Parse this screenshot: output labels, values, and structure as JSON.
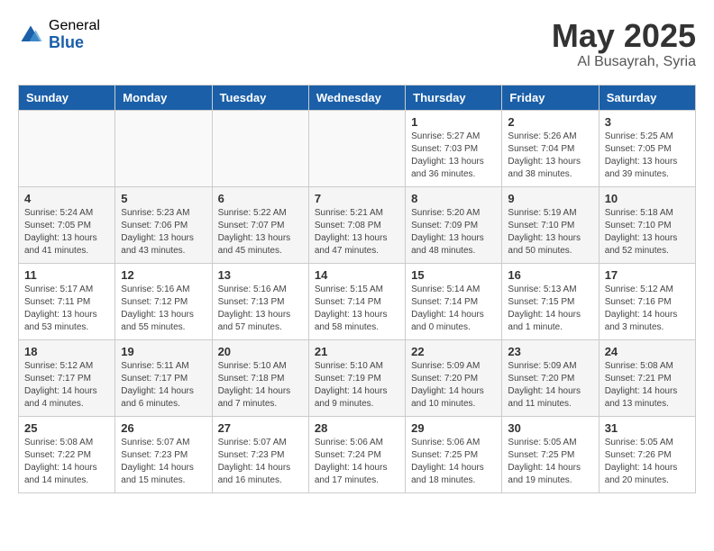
{
  "header": {
    "logo_general": "General",
    "logo_blue": "Blue",
    "month_title": "May 2025",
    "location": "Al Busayrah, Syria"
  },
  "days_of_week": [
    "Sunday",
    "Monday",
    "Tuesday",
    "Wednesday",
    "Thursday",
    "Friday",
    "Saturday"
  ],
  "weeks": [
    {
      "days": [
        {
          "num": "",
          "info": ""
        },
        {
          "num": "",
          "info": ""
        },
        {
          "num": "",
          "info": ""
        },
        {
          "num": "",
          "info": ""
        },
        {
          "num": "1",
          "info": "Sunrise: 5:27 AM\nSunset: 7:03 PM\nDaylight: 13 hours\nand 36 minutes."
        },
        {
          "num": "2",
          "info": "Sunrise: 5:26 AM\nSunset: 7:04 PM\nDaylight: 13 hours\nand 38 minutes."
        },
        {
          "num": "3",
          "info": "Sunrise: 5:25 AM\nSunset: 7:05 PM\nDaylight: 13 hours\nand 39 minutes."
        }
      ]
    },
    {
      "days": [
        {
          "num": "4",
          "info": "Sunrise: 5:24 AM\nSunset: 7:05 PM\nDaylight: 13 hours\nand 41 minutes."
        },
        {
          "num": "5",
          "info": "Sunrise: 5:23 AM\nSunset: 7:06 PM\nDaylight: 13 hours\nand 43 minutes."
        },
        {
          "num": "6",
          "info": "Sunrise: 5:22 AM\nSunset: 7:07 PM\nDaylight: 13 hours\nand 45 minutes."
        },
        {
          "num": "7",
          "info": "Sunrise: 5:21 AM\nSunset: 7:08 PM\nDaylight: 13 hours\nand 47 minutes."
        },
        {
          "num": "8",
          "info": "Sunrise: 5:20 AM\nSunset: 7:09 PM\nDaylight: 13 hours\nand 48 minutes."
        },
        {
          "num": "9",
          "info": "Sunrise: 5:19 AM\nSunset: 7:10 PM\nDaylight: 13 hours\nand 50 minutes."
        },
        {
          "num": "10",
          "info": "Sunrise: 5:18 AM\nSunset: 7:10 PM\nDaylight: 13 hours\nand 52 minutes."
        }
      ]
    },
    {
      "days": [
        {
          "num": "11",
          "info": "Sunrise: 5:17 AM\nSunset: 7:11 PM\nDaylight: 13 hours\nand 53 minutes."
        },
        {
          "num": "12",
          "info": "Sunrise: 5:16 AM\nSunset: 7:12 PM\nDaylight: 13 hours\nand 55 minutes."
        },
        {
          "num": "13",
          "info": "Sunrise: 5:16 AM\nSunset: 7:13 PM\nDaylight: 13 hours\nand 57 minutes."
        },
        {
          "num": "14",
          "info": "Sunrise: 5:15 AM\nSunset: 7:14 PM\nDaylight: 13 hours\nand 58 minutes."
        },
        {
          "num": "15",
          "info": "Sunrise: 5:14 AM\nSunset: 7:14 PM\nDaylight: 14 hours\nand 0 minutes."
        },
        {
          "num": "16",
          "info": "Sunrise: 5:13 AM\nSunset: 7:15 PM\nDaylight: 14 hours\nand 1 minute."
        },
        {
          "num": "17",
          "info": "Sunrise: 5:12 AM\nSunset: 7:16 PM\nDaylight: 14 hours\nand 3 minutes."
        }
      ]
    },
    {
      "days": [
        {
          "num": "18",
          "info": "Sunrise: 5:12 AM\nSunset: 7:17 PM\nDaylight: 14 hours\nand 4 minutes."
        },
        {
          "num": "19",
          "info": "Sunrise: 5:11 AM\nSunset: 7:17 PM\nDaylight: 14 hours\nand 6 minutes."
        },
        {
          "num": "20",
          "info": "Sunrise: 5:10 AM\nSunset: 7:18 PM\nDaylight: 14 hours\nand 7 minutes."
        },
        {
          "num": "21",
          "info": "Sunrise: 5:10 AM\nSunset: 7:19 PM\nDaylight: 14 hours\nand 9 minutes."
        },
        {
          "num": "22",
          "info": "Sunrise: 5:09 AM\nSunset: 7:20 PM\nDaylight: 14 hours\nand 10 minutes."
        },
        {
          "num": "23",
          "info": "Sunrise: 5:09 AM\nSunset: 7:20 PM\nDaylight: 14 hours\nand 11 minutes."
        },
        {
          "num": "24",
          "info": "Sunrise: 5:08 AM\nSunset: 7:21 PM\nDaylight: 14 hours\nand 13 minutes."
        }
      ]
    },
    {
      "days": [
        {
          "num": "25",
          "info": "Sunrise: 5:08 AM\nSunset: 7:22 PM\nDaylight: 14 hours\nand 14 minutes."
        },
        {
          "num": "26",
          "info": "Sunrise: 5:07 AM\nSunset: 7:23 PM\nDaylight: 14 hours\nand 15 minutes."
        },
        {
          "num": "27",
          "info": "Sunrise: 5:07 AM\nSunset: 7:23 PM\nDaylight: 14 hours\nand 16 minutes."
        },
        {
          "num": "28",
          "info": "Sunrise: 5:06 AM\nSunset: 7:24 PM\nDaylight: 14 hours\nand 17 minutes."
        },
        {
          "num": "29",
          "info": "Sunrise: 5:06 AM\nSunset: 7:25 PM\nDaylight: 14 hours\nand 18 minutes."
        },
        {
          "num": "30",
          "info": "Sunrise: 5:05 AM\nSunset: 7:25 PM\nDaylight: 14 hours\nand 19 minutes."
        },
        {
          "num": "31",
          "info": "Sunrise: 5:05 AM\nSunset: 7:26 PM\nDaylight: 14 hours\nand 20 minutes."
        }
      ]
    }
  ]
}
